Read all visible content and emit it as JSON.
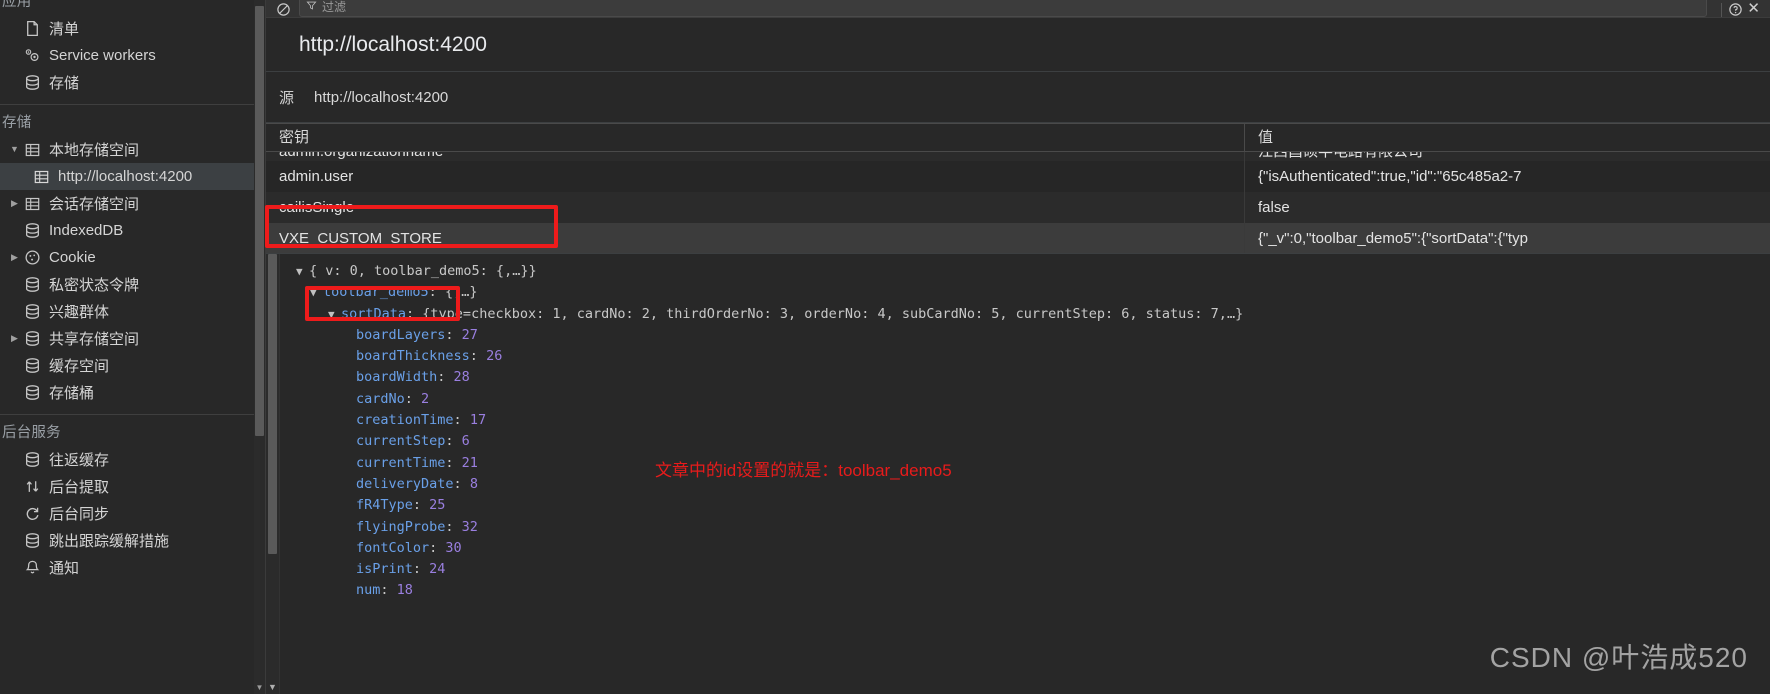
{
  "sidebar": {
    "app_section": {
      "title": "应用",
      "items": [
        {
          "label": "清单",
          "icon": "document-icon"
        },
        {
          "label": "Service workers",
          "icon": "gears-icon"
        },
        {
          "label": "存储",
          "icon": "database-icon"
        }
      ]
    },
    "storage_section": {
      "title": "存储",
      "items": [
        {
          "label": "本地存储空间",
          "icon": "table-icon",
          "twisty": "▼",
          "indent": false,
          "selected": false
        },
        {
          "label": "http://localhost:4200",
          "icon": "table-icon",
          "twisty": "",
          "indent": true,
          "selected": true
        },
        {
          "label": "会话存储空间",
          "icon": "table-icon",
          "twisty": "▶",
          "indent": false,
          "selected": false
        },
        {
          "label": "IndexedDB",
          "icon": "database-icon",
          "twisty": "",
          "indent": false,
          "selected": false
        },
        {
          "label": "Cookie",
          "icon": "cookie-icon",
          "twisty": "▶",
          "indent": false,
          "selected": false
        },
        {
          "label": "私密状态令牌",
          "icon": "database-icon",
          "twisty": "",
          "indent": false,
          "selected": false
        },
        {
          "label": "兴趣群体",
          "icon": "database-icon",
          "twisty": "",
          "indent": false,
          "selected": false
        },
        {
          "label": "共享存储空间",
          "icon": "database-icon",
          "twisty": "▶",
          "indent": false,
          "selected": false
        },
        {
          "label": "缓存空间",
          "icon": "database-icon",
          "twisty": "",
          "indent": false,
          "selected": false
        },
        {
          "label": "存储桶",
          "icon": "database-icon",
          "twisty": "",
          "indent": false,
          "selected": false
        }
      ]
    },
    "background_section": {
      "title": "后台服务",
      "items": [
        {
          "label": "往返缓存",
          "icon": "database-icon"
        },
        {
          "label": "后台提取",
          "icon": "arrows-updown-icon"
        },
        {
          "label": "后台同步",
          "icon": "sync-icon"
        },
        {
          "label": "跳出跟踪缓解措施",
          "icon": "database-icon"
        },
        {
          "label": "通知",
          "icon": "bell-icon"
        }
      ]
    }
  },
  "toolbar": {
    "clear_icon": "clear-forbidden-icon",
    "filter_placeholder": "过滤",
    "filter_value": "",
    "filter_icon": "filter-icon",
    "help_icon": "help-circle-icon",
    "close_label": "✕"
  },
  "header": {
    "url_title": "http://localhost:4200",
    "origin_key": "源",
    "origin_value": "http://localhost:4200"
  },
  "table": {
    "columns": [
      "密钥",
      "值"
    ],
    "rows": [
      {
        "key": "admin.organizationname",
        "value": "江西昌硕半电路有限公司",
        "selected": false,
        "clipped": true
      },
      {
        "key": "admin.user",
        "value": "{\"isAuthenticated\":true,\"id\":\"65c485a2-7",
        "selected": false,
        "clipped": false
      },
      {
        "key": "cailisSingle",
        "value": "false",
        "selected": false,
        "clipped": false
      },
      {
        "key": "VXE_CUSTOM_STORE",
        "value": "{\"_v\":0,\"toolbar_demo5\":{\"sortData\":{\"typ",
        "selected": true,
        "clipped": false
      }
    ]
  },
  "preview_tree": {
    "root": {
      "twisty": "▼",
      "text": "{ v: 0, toolbar_demo5: {,…}}"
    },
    "node": {
      "twisty": "▼",
      "key": "toolbar_demo5",
      "suffix": "{,…}"
    },
    "sort_data": {
      "twisty": "▼",
      "key": "sortData",
      "value": "{type=checkbox: 1, cardNo: 2, thirdOrderNo: 3, orderNo: 4, subCardNo: 5, currentStep: 6, status: 7,…}"
    },
    "properties": [
      {
        "key": "boardLayers",
        "value": "27"
      },
      {
        "key": "boardThickness",
        "value": "26"
      },
      {
        "key": "boardWidth",
        "value": "28"
      },
      {
        "key": "cardNo",
        "value": "2"
      },
      {
        "key": "creationTime",
        "value": "17"
      },
      {
        "key": "currentStep",
        "value": "6"
      },
      {
        "key": "currentTime",
        "value": "21"
      },
      {
        "key": "deliveryDate",
        "value": "8"
      },
      {
        "key": "fR4Type",
        "value": "25"
      },
      {
        "key": "flyingProbe",
        "value": "32"
      },
      {
        "key": "fontColor",
        "value": "30"
      },
      {
        "key": "isPrint",
        "value": "24"
      },
      {
        "key": "num",
        "value": "18"
      }
    ]
  },
  "annotations": {
    "note_text": "文章中的id设置的就是：toolbar_demo5",
    "highlight_color": "#ee1b1b",
    "watermark": "CSDN @叶浩成520"
  }
}
